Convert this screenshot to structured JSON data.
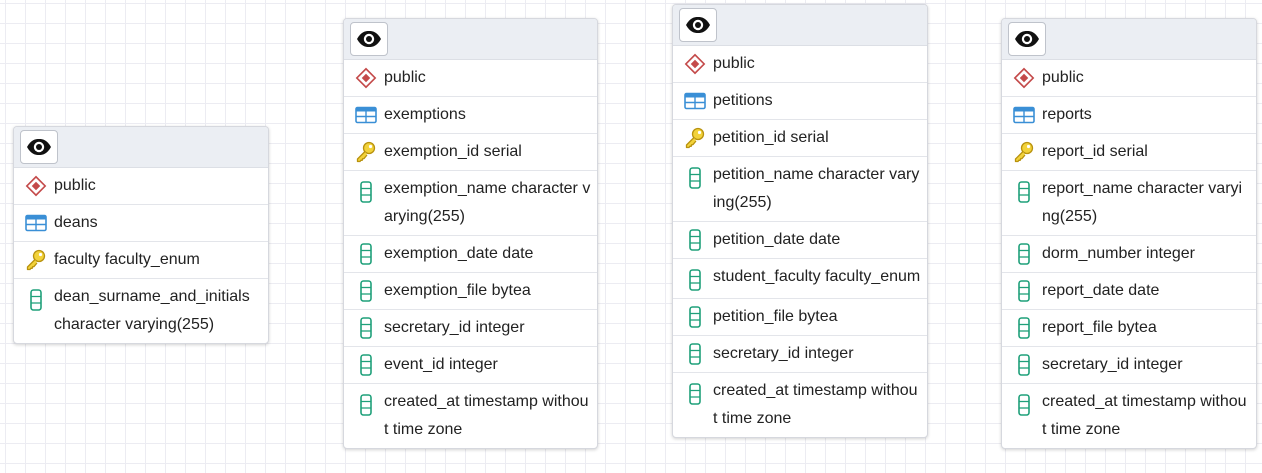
{
  "diagram": {
    "nodes": [
      {
        "id": "deans",
        "schema": "public",
        "table": "deans",
        "columns": [
          {
            "kind": "key",
            "text": "faculty faculty_enum"
          },
          {
            "kind": "column",
            "text": "dean_surname_and_initials character varying(255)"
          }
        ]
      },
      {
        "id": "exemptions",
        "schema": "public",
        "table": "exemptions",
        "columns": [
          {
            "kind": "key",
            "text": "exemption_id serial"
          },
          {
            "kind": "column",
            "text": "exemption_name character varying(255)"
          },
          {
            "kind": "column",
            "text": "exemption_date date"
          },
          {
            "kind": "column",
            "text": "exemption_file bytea"
          },
          {
            "kind": "column",
            "text": "secretary_id integer"
          },
          {
            "kind": "column",
            "text": "event_id integer"
          },
          {
            "kind": "column",
            "text": "created_at timestamp without time zone"
          }
        ]
      },
      {
        "id": "petitions",
        "schema": "public",
        "table": "petitions",
        "columns": [
          {
            "kind": "key",
            "text": "petition_id serial"
          },
          {
            "kind": "column",
            "text": "petition_name character varying(255)"
          },
          {
            "kind": "column",
            "text": "petition_date date"
          },
          {
            "kind": "column",
            "text": "student_faculty faculty_enum"
          },
          {
            "kind": "column",
            "text": "petition_file bytea"
          },
          {
            "kind": "column",
            "text": "secretary_id integer"
          },
          {
            "kind": "column",
            "text": "created_at timestamp without time zone"
          }
        ]
      },
      {
        "id": "reports",
        "schema": "public",
        "table": "reports",
        "columns": [
          {
            "kind": "key",
            "text": "report_id serial"
          },
          {
            "kind": "column",
            "text": "report_name character varying(255)"
          },
          {
            "kind": "column",
            "text": "dorm_number integer"
          },
          {
            "kind": "column",
            "text": "report_date date"
          },
          {
            "kind": "column",
            "text": "report_file bytea"
          },
          {
            "kind": "column",
            "text": "secretary_id integer"
          },
          {
            "kind": "column",
            "text": "created_at timestamp without time zone"
          }
        ]
      }
    ],
    "icons": {
      "view": "eye-icon",
      "schema": "schema-icon",
      "table": "table-icon",
      "key": "primary-key-icon",
      "column": "column-icon"
    },
    "colors": {
      "schema_icon": "#c44a4a",
      "table_icon": "#3a8fd6",
      "key_icon": "#e8c21a",
      "column_icon": "#1fa07a",
      "header_bg": "#ebeef3"
    }
  }
}
